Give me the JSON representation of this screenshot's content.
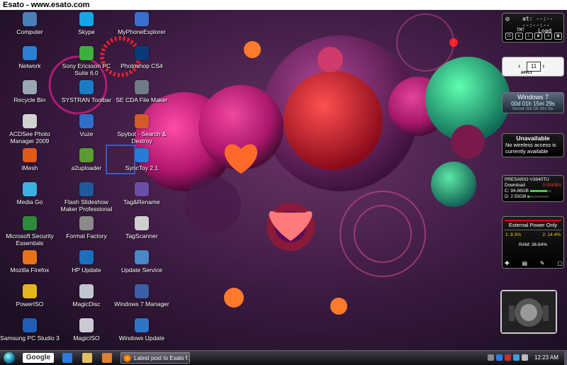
{
  "watermark": "Esato - www.esato.com",
  "desktop_icons": [
    {
      "label": "Computer",
      "icon": "computer-icon",
      "color": "#4a7fb8"
    },
    {
      "label": "Skype",
      "icon": "skype-icon",
      "color": "#13a6e6"
    },
    {
      "label": "MyPhoneExplorer",
      "icon": "phone-explorer-icon",
      "color": "#3a6fd1"
    },
    {
      "label": "Network",
      "icon": "network-icon",
      "color": "#2c7fd6"
    },
    {
      "label": "Sony Ericsson PC Suite 6.0",
      "icon": "pc-suite-icon",
      "color": "#3bb13b"
    },
    {
      "label": "Photoshop CS4",
      "icon": "photoshop-icon",
      "color": "#0a3a7a"
    },
    {
      "label": "Recycle Bin",
      "icon": "recycle-bin-icon",
      "color": "#9aa7b3"
    },
    {
      "label": "SYSTRAN Toolbar",
      "icon": "systran-icon",
      "color": "#1a7dc4"
    },
    {
      "label": "SE CDA File Maker",
      "icon": "cda-file-icon",
      "color": "#6f7b86"
    },
    {
      "label": "ACDSee Photo Manager 2009",
      "icon": "acdsee-icon",
      "color": "#d1d1d1"
    },
    {
      "label": "Vuze",
      "icon": "vuze-icon",
      "color": "#2f6fc8"
    },
    {
      "label": "Spybot - Search & Destroy",
      "icon": "spybot-icon",
      "color": "#d25a2b"
    },
    {
      "label": "iMesh",
      "icon": "imesh-icon",
      "color": "#e05a1a"
    },
    {
      "label": "a2uploader",
      "icon": "a2uploader-icon",
      "color": "#5a9b33"
    },
    {
      "label": "SyncToy 2.1",
      "icon": "synctoy-icon",
      "color": "#2a7bd6"
    },
    {
      "label": "Media Go",
      "icon": "media-go-icon",
      "color": "#3cb0e0"
    },
    {
      "label": "Flash Slideshow Maker Professional",
      "icon": "slideshow-icon",
      "color": "#1f5a9c"
    },
    {
      "label": "Tag&Rename",
      "icon": "tag-rename-icon",
      "color": "#6b4ea8"
    },
    {
      "label": "Microsoft Security Essentials",
      "icon": "security-essentials-icon",
      "color": "#2e8b3b"
    },
    {
      "label": "Format Factory",
      "icon": "format-factory-icon",
      "color": "#8a8a8a"
    },
    {
      "label": "TagScanner",
      "icon": "magnifier-icon",
      "color": "#cfcfcf"
    },
    {
      "label": "Mozilla Firefox",
      "icon": "firefox-icon",
      "color": "#e8731a"
    },
    {
      "label": "HP Update",
      "icon": "hp-update-icon",
      "color": "#1c6fbf"
    },
    {
      "label": "Update Service",
      "icon": "update-service-icon",
      "color": "#4a88c8"
    },
    {
      "label": "PowerISO",
      "icon": "poweriso-icon",
      "color": "#e3b51c"
    },
    {
      "label": "MagicDisc",
      "icon": "disc-icon",
      "color": "#c0c6d0"
    },
    {
      "label": "Windows 7 Manager",
      "icon": "win7-manager-icon",
      "color": "#3a5ea8"
    },
    {
      "label": "Samsung PC Studio 3",
      "icon": "samsung-studio-icon",
      "color": "#1f5fb8"
    },
    {
      "label": "MagicISO",
      "icon": "magiciso-icon",
      "color": "#c9c9d4"
    },
    {
      "label": "Windows Update",
      "icon": "windows-update-icon",
      "color": "#2e74c8"
    }
  ],
  "gadgets": {
    "clock": {
      "at": "at: --:--",
      "time": "--:--:--",
      "mode": "TMT",
      "load": "Load"
    },
    "calendar": {
      "day": "11",
      "apply": "APPLY"
    },
    "uptime": {
      "os": "Windows 7",
      "uptime": "00d 01h 15m 29s",
      "record": "Record: 02d 13h 20m 26s"
    },
    "wireless": {
      "title": "Unavailable",
      "message": "No wireless access is currently available"
    },
    "disk": {
      "model": "PRESARIO V3840TU",
      "download_label": "Download",
      "download_value": "0.00KB/s",
      "c_label": "C:",
      "c_value": "94.86GB",
      "d_label": "D:",
      "d_value": "2.55GB",
      "c_fill": 0.8,
      "d_fill": 0.1
    },
    "power": {
      "title": "External Power Only",
      "cpu1": "1: 8.3%",
      "cpu2": "2: 14.4%",
      "ram": "RAM: 36.64%"
    }
  },
  "taskbar": {
    "google": "Google",
    "task_label": "Latest post to Esato f...",
    "clock": "12:23 AM"
  }
}
